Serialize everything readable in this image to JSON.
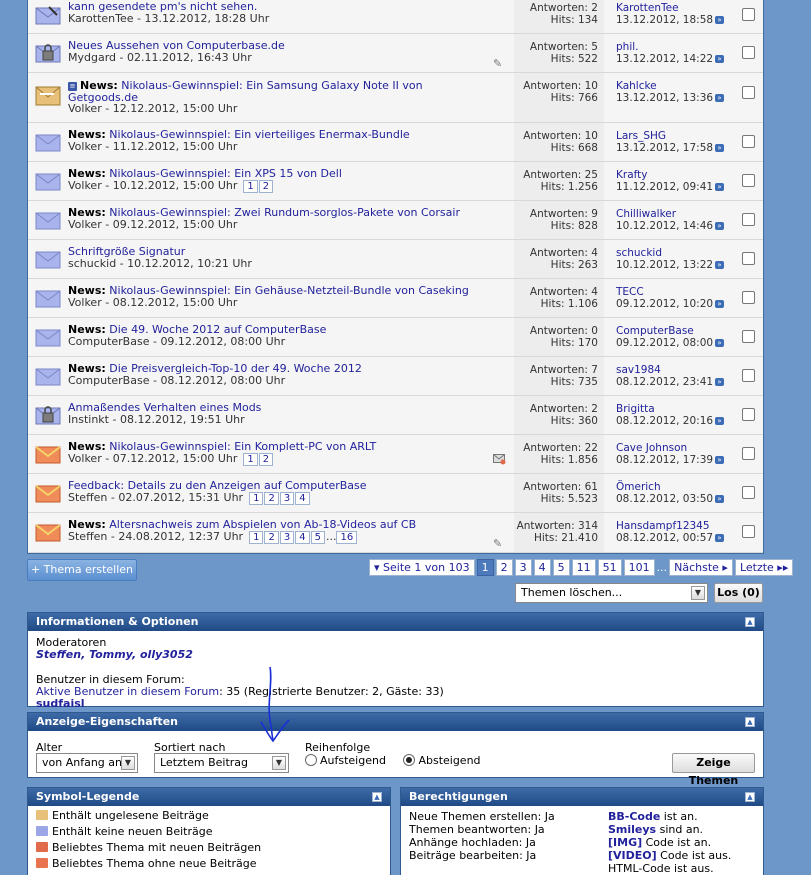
{
  "threads": [
    {
      "icon": "sent-pm-icon",
      "prefix": "",
      "title": "kann gesendete pm's nicht sehen.",
      "author": "KarottenTee",
      "date": "13.12.2012, 18:28 Uhr",
      "pages": [],
      "replies": "Antworten: 2",
      "hits": "Hits: 134",
      "last_user": "KarottenTee",
      "last_date": "13.12.2012, 18:58",
      "attach": ""
    },
    {
      "icon": "locked-thread-icon",
      "prefix": "",
      "title": "Neues Aussehen von Computerbase.de",
      "author": "Mydgard",
      "date": "02.11.2012, 16:43 Uhr",
      "pages": [],
      "replies": "Antworten: 5",
      "hits": "Hits: 522",
      "last_user": "phil.",
      "last_date": "13.12.2012, 14:22",
      "attach": "paperclip"
    },
    {
      "icon": "new-posts-icon",
      "prefix": "News:",
      "title": "Nikolaus-Gewinnspiel: Ein Samsung Galaxy Note II von Getgoods.de",
      "author": "Volker",
      "date": "12.12.2012, 15:00 Uhr",
      "pages": [],
      "replies": "Antworten: 10",
      "hits": "Hits: 766",
      "last_user": "Kahlcke",
      "last_date": "13.12.2012, 13:36",
      "attach": ""
    },
    {
      "icon": "no-new-posts-icon",
      "prefix": "News:",
      "title": "Nikolaus-Gewinnspiel: Ein vierteiliges Enermax-Bundle",
      "author": "Volker",
      "date": "11.12.2012, 15:00 Uhr",
      "pages": [],
      "replies": "Antworten: 10",
      "hits": "Hits: 668",
      "last_user": "Lars_SHG",
      "last_date": "13.12.2012, 17:58",
      "attach": ""
    },
    {
      "icon": "no-new-posts-icon",
      "prefix": "News:",
      "title": "Nikolaus-Gewinnspiel: Ein XPS 15 von Dell",
      "author": "Volker",
      "date": "10.12.2012, 15:00 Uhr",
      "pages": [
        "1",
        "2"
      ],
      "replies": "Antworten: 25",
      "hits": "Hits: 1.256",
      "last_user": "Krafty",
      "last_date": "11.12.2012, 09:41",
      "attach": ""
    },
    {
      "icon": "no-new-posts-icon",
      "prefix": "News:",
      "title": "Nikolaus-Gewinnspiel: Zwei Rundum-sorglos-Pakete von Corsair",
      "author": "Volker",
      "date": "09.12.2012, 15:00 Uhr",
      "pages": [],
      "replies": "Antworten: 9",
      "hits": "Hits: 828",
      "last_user": "Chilliwalker",
      "last_date": "10.12.2012, 14:46",
      "attach": ""
    },
    {
      "icon": "no-new-posts-icon",
      "prefix": "",
      "title": "Schriftgröße Signatur",
      "author": "schuckid",
      "date": "10.12.2012, 10:21 Uhr",
      "pages": [],
      "replies": "Antworten: 4",
      "hits": "Hits: 263",
      "last_user": "schuckid",
      "last_date": "10.12.2012, 13:22",
      "attach": ""
    },
    {
      "icon": "no-new-posts-icon",
      "prefix": "News:",
      "title": "Nikolaus-Gewinnspiel: Ein Gehäuse-Netzteil-Bundle von Caseking",
      "author": "Volker",
      "date": "08.12.2012, 15:00 Uhr",
      "pages": [],
      "replies": "Antworten: 4",
      "hits": "Hits: 1.106",
      "last_user": "TECC",
      "last_date": "09.12.2012, 10:20",
      "attach": ""
    },
    {
      "icon": "no-new-posts-icon",
      "prefix": "News:",
      "title": "Die 49. Woche 2012 auf ComputerBase",
      "author": "ComputerBase",
      "date": "09.12.2012, 08:00 Uhr",
      "pages": [],
      "replies": "Antworten: 0",
      "hits": "Hits: 170",
      "last_user": "ComputerBase",
      "last_date": "09.12.2012, 08:00",
      "attach": ""
    },
    {
      "icon": "no-new-posts-icon",
      "prefix": "News:",
      "title": "Die Preisvergleich-Top-10 der 49. Woche 2012",
      "author": "ComputerBase",
      "date": "08.12.2012, 08:00 Uhr",
      "pages": [],
      "replies": "Antworten: 7",
      "hits": "Hits: 735",
      "last_user": "sav1984",
      "last_date": "08.12.2012, 23:41",
      "attach": ""
    },
    {
      "icon": "locked-thread-icon",
      "prefix": "",
      "title": "Anmaßendes Verhalten eines Mods",
      "author": "Instinkt",
      "date": "08.12.2012, 19:51 Uhr",
      "pages": [],
      "replies": "Antworten: 2",
      "hits": "Hits: 360",
      "last_user": "Brigitta",
      "last_date": "08.12.2012, 20:16",
      "attach": ""
    },
    {
      "icon": "favorite-no-new-icon",
      "prefix": "News:",
      "title": "Nikolaus-Gewinnspiel: Ein Komplett-PC von ARLT",
      "author": "Volker",
      "date": "07.12.2012, 15:00 Uhr",
      "pages": [
        "1",
        "2"
      ],
      "replies": "Antworten: 22",
      "hits": "Hits: 1.856",
      "last_user": "Cave Johnson",
      "last_date": "08.12.2012, 17:39",
      "attach": "mail"
    },
    {
      "icon": "favorite-no-new-icon",
      "prefix": "",
      "title": "Feedback: Details zu den Anzeigen auf ComputerBase",
      "author": "Steffen",
      "date": "02.07.2012, 15:31 Uhr",
      "pages": [
        "1",
        "2",
        "3",
        "4"
      ],
      "replies": "Antworten: 61",
      "hits": "Hits: 5.523",
      "last_user": "Ömerich",
      "last_date": "08.12.2012, 03:50",
      "attach": ""
    },
    {
      "icon": "favorite-no-new-icon",
      "prefix": "News:",
      "title": "Altersnachweis zum Abspielen von Ab-18-Videos auf CB",
      "author": "Steffen",
      "date": "24.08.2012, 12:37 Uhr",
      "pages": [
        "1",
        "2",
        "3",
        "4",
        "5",
        "...",
        "16"
      ],
      "replies": "Antworten: 314",
      "hits": "Hits: 21.410",
      "last_user": "Hansdampf12345",
      "last_date": "08.12.2012, 00:57",
      "attach": "paperclip"
    }
  ],
  "toolbar": {
    "new_thread": "+ Thema erstellen",
    "page_info": "▾ Seite 1 von 103",
    "pages": [
      "1",
      "2",
      "3",
      "4",
      "5",
      "11",
      "51",
      "101"
    ],
    "ellipsis": "...",
    "next": "Nächste ▸",
    "last": "Letzte ▸▸",
    "mod_select": "Themen löschen...",
    "go": "Los (0)"
  },
  "info": {
    "heading": "Informationen & Optionen",
    "moderators_label": "Moderatoren",
    "moderators": "Steffen, Tommy, olly3052",
    "users_label": "Benutzer in diesem Forum:",
    "active_link": "Aktive Benutzer in diesem Forum",
    "active_count": ": 35 (Registrierte Benutzer: 2, Gäste: 33)",
    "active_user": "sudfaisl"
  },
  "display": {
    "heading": "Anzeige-Eigenschaften",
    "age_label": "Alter",
    "age_value": "von Anfang an",
    "sort_label": "Sortiert nach",
    "sort_value": "Letztem Beitrag",
    "order_label": "Reihenfolge",
    "asc": "Aufsteigend",
    "desc": "Absteigend",
    "show": "Zeige Themen"
  },
  "legend": {
    "heading": "Symbol-Legende",
    "items": [
      {
        "label": "Enthält ungelesene Beiträge",
        "color": "#e8c079"
      },
      {
        "label": "Enthält keine neuen Beiträge",
        "color": "#9aa6e6"
      },
      {
        "label": "Beliebtes Thema mit neuen Beiträgen",
        "color": "#e06a4a"
      },
      {
        "label": "Beliebtes Thema ohne neue Beiträge",
        "color": "#e8734e"
      }
    ]
  },
  "permissions": {
    "heading": "Berechtigungen",
    "left": [
      "Neue Themen erstellen: Ja",
      "Themen beantworten: Ja",
      "Anhänge hochladen: Ja",
      "Beiträge bearbeiten: Ja"
    ],
    "right": [
      {
        "strong": "BB-Code",
        "rest": " ist an."
      },
      {
        "strong": "Smileys",
        "rest": " sind an."
      },
      {
        "strong": "[IMG]",
        "rest": " Code ist an."
      },
      {
        "strong": "[VIDEO]",
        "rest": " Code ist aus."
      },
      {
        "strong": "",
        "rest": "HTML-Code ist aus."
      }
    ]
  },
  "colors": {
    "accent": "#22229c",
    "header": "#2e5a8f",
    "background": "#6d97c8"
  }
}
